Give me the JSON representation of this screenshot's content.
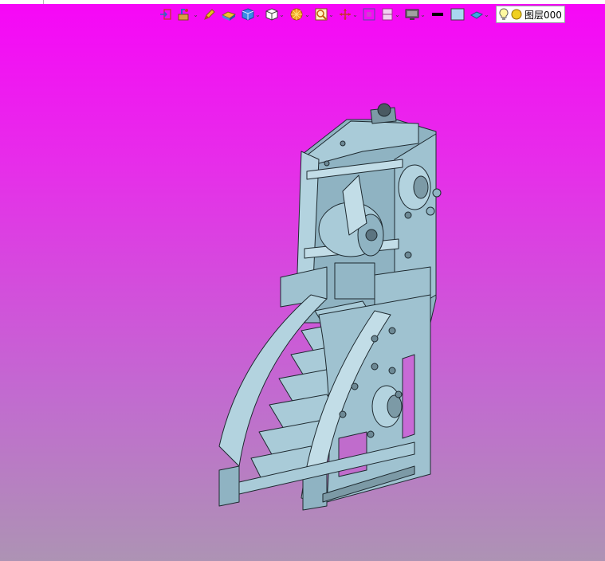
{
  "toolbar": {
    "icons": [
      {
        "name": "exit-sketch-icon",
        "dropdown": false
      },
      {
        "name": "sketch-tools-icon",
        "dropdown": true
      },
      {
        "name": "pencil-icon",
        "dropdown": false
      },
      {
        "name": "material-icon",
        "dropdown": false
      },
      {
        "name": "solid-view-icon",
        "dropdown": true
      },
      {
        "name": "cube-icon",
        "dropdown": true
      },
      {
        "name": "render-icon",
        "dropdown": true
      },
      {
        "name": "zoom-window-icon",
        "dropdown": true
      },
      {
        "name": "move-icon",
        "dropdown": true
      },
      {
        "name": "fit-view-icon",
        "dropdown": false
      },
      {
        "name": "section-view-icon",
        "dropdown": true
      },
      {
        "name": "display-mode-icon",
        "dropdown": true
      },
      {
        "name": "line-color-icon",
        "dropdown": false
      },
      {
        "name": "fill-color-icon",
        "dropdown": false
      },
      {
        "name": "layer-shape-icon",
        "dropdown": true
      }
    ],
    "layer_label": "图层000"
  },
  "colors": {
    "background_top": "#f706f7",
    "background_bottom": "#ad93b4",
    "model_face": "#9fc2d0",
    "model_edge": "#1e2a30"
  }
}
